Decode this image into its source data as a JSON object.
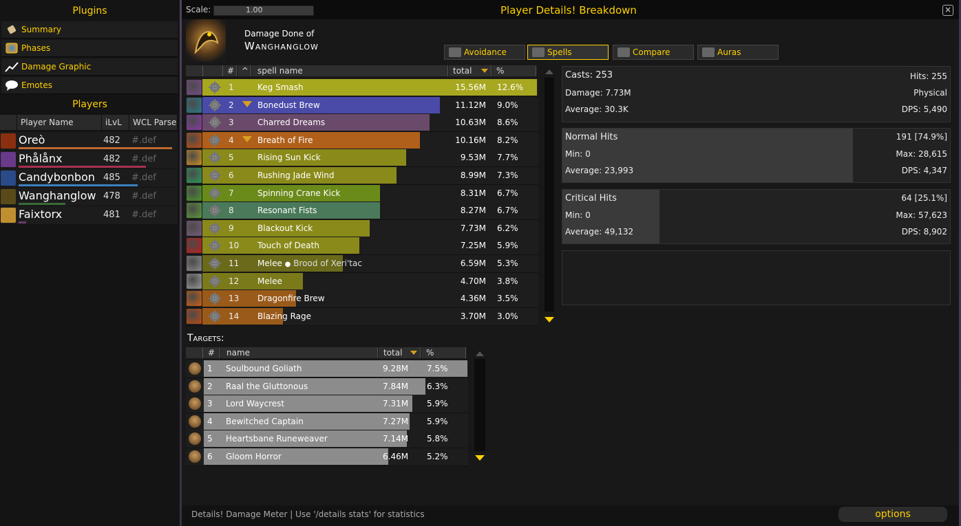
{
  "plugins": {
    "title": "Plugins",
    "items": [
      {
        "label": "Summary",
        "icon": "scroll-icon"
      },
      {
        "label": "Phases",
        "icon": "compass-icon"
      },
      {
        "label": "Damage Graphic",
        "icon": "line-chart-icon"
      },
      {
        "label": "Emotes",
        "icon": "speech-bubble-icon"
      }
    ]
  },
  "players": {
    "title": "Players",
    "headers": [
      "Player Name",
      "iLvL",
      "WCL Parse"
    ],
    "rows": [
      {
        "name": "Oreò",
        "ilvl": "482",
        "parse": "#.def",
        "color": "#8a3010",
        "bar_color": "#c06a30",
        "bar_fraction": 0.98
      },
      {
        "name": "Phålånx",
        "ilvl": "482",
        "parse": "#.def",
        "color": "#6a3a8a",
        "bar_color": "#a83050",
        "bar_fraction": 0.81
      },
      {
        "name": "Candybonbon",
        "ilvl": "485",
        "parse": "#.def",
        "color": "#2a4a8a",
        "bar_color": "#3a80c0",
        "bar_fraction": 0.76
      },
      {
        "name": "Wanghanglow",
        "ilvl": "478",
        "parse": "#.def",
        "color": "#5a4a1a",
        "bar_color": "#3a6a3a",
        "bar_fraction": 0.3
      },
      {
        "name": "Faixtorx",
        "ilvl": "481",
        "parse": "#.def",
        "color": "#c09030",
        "bar_color": "#6a3a6a",
        "bar_fraction": 0.05
      }
    ]
  },
  "window": {
    "scale_label": "Scale:",
    "scale_value": "1.00",
    "title": "Player Details! Breakdown",
    "damage_done_of": "Damage Done of",
    "player_name": "Wanghanglow"
  },
  "tabs": [
    {
      "label": "Avoidance",
      "icon": "shield-icon",
      "active": false
    },
    {
      "label": "Spells",
      "icon": "swords-icon",
      "active": true
    },
    {
      "label": "Compare",
      "icon": "crown-icon",
      "active": false
    },
    {
      "label": "Auras",
      "icon": "aura-icon",
      "active": false
    }
  ],
  "spell_table": {
    "headers": {
      "num": "#",
      "sort": "^",
      "name": "spell name",
      "total": "total",
      "pct": "%"
    },
    "rows": [
      {
        "num": "1",
        "name": "Keg Smash",
        "total": "15.56M",
        "pct": "12.6%",
        "fraction": 1.0,
        "color": "#a8a820",
        "icon_color": "#7a4a8a",
        "arrow": false
      },
      {
        "num": "2",
        "name": "Bonedust Brew",
        "total": "11.12M",
        "pct": "9.0%",
        "fraction": 0.71,
        "color": "#4a4aa8",
        "icon_color": "#2a7a8a",
        "arrow": true
      },
      {
        "num": "3",
        "name": "Charred Dreams",
        "total": "10.63M",
        "pct": "8.6%",
        "fraction": 0.68,
        "color": "#6a4a6a",
        "icon_color": "#8a3aaa",
        "arrow": false
      },
      {
        "num": "4",
        "name": "Breath of Fire",
        "total": "10.16M",
        "pct": "8.2%",
        "fraction": 0.65,
        "color": "#b0601a",
        "icon_color": "#c05010",
        "arrow": true
      },
      {
        "num": "5",
        "name": "Rising Sun Kick",
        "total": "9.53M",
        "pct": "7.7%",
        "fraction": 0.61,
        "color": "#8a8a1a",
        "icon_color": "#d09020",
        "arrow": false
      },
      {
        "num": "6",
        "name": "Rushing Jade Wind",
        "total": "8.99M",
        "pct": "7.3%",
        "fraction": 0.58,
        "color": "#8a8a1a",
        "icon_color": "#2a9a5a",
        "arrow": false
      },
      {
        "num": "7",
        "name": "Spinning Crane Kick",
        "total": "8.31M",
        "pct": "6.7%",
        "fraction": 0.53,
        "color": "#6a8a1a",
        "icon_color": "#4a9a2a",
        "arrow": false
      },
      {
        "num": "8",
        "name": "Resonant Fists",
        "total": "8.27M",
        "pct": "6.7%",
        "fraction": 0.53,
        "color": "#4a7a5a",
        "icon_color": "#5a9a3a",
        "arrow": false
      },
      {
        "num": "9",
        "name": "Blackout Kick",
        "total": "7.73M",
        "pct": "6.2%",
        "fraction": 0.5,
        "color": "#8a8a1a",
        "icon_color": "#7a5a7a",
        "arrow": false
      },
      {
        "num": "10",
        "name": "Touch of Death",
        "total": "7.25M",
        "pct": "5.9%",
        "fraction": 0.47,
        "color": "#8a8a1a",
        "icon_color": "#c01a1a",
        "arrow": false
      },
      {
        "num": "11",
        "name": "Melee",
        "pet": "Brood of Xeri'tac",
        "total": "6.59M",
        "pct": "5.3%",
        "fraction": 0.42,
        "color": "#6a6a1a",
        "icon_color": "#8a8a8a",
        "arrow": false
      },
      {
        "num": "12",
        "name": "Melee",
        "total": "4.70M",
        "pct": "3.8%",
        "fraction": 0.3,
        "color": "#7a7a1a",
        "icon_color": "#9a9a9a",
        "arrow": false
      },
      {
        "num": "13",
        "name": "Dragonfire Brew",
        "total": "4.36M",
        "pct": "3.5%",
        "fraction": 0.28,
        "color": "#9a5a1a",
        "icon_color": "#d06010",
        "arrow": false
      },
      {
        "num": "14",
        "name": "Blazing Rage",
        "total": "3.70M",
        "pct": "3.0%",
        "fraction": 0.24,
        "color": "#9a5a1a",
        "icon_color": "#c04a10",
        "arrow": false
      }
    ]
  },
  "targets": {
    "title": "Targets:",
    "headers": {
      "num": "#",
      "name": "name",
      "total": "total",
      "pct": "%"
    },
    "rows": [
      {
        "num": "1",
        "name": "Soulbound Goliath",
        "total": "9.28M",
        "pct": "7.5%",
        "fraction": 1.0
      },
      {
        "num": "2",
        "name": "Raal the Gluttonous",
        "total": "7.84M",
        "pct": "6.3%",
        "fraction": 0.84
      },
      {
        "num": "3",
        "name": "Lord Waycrest",
        "total": "7.31M",
        "pct": "5.9%",
        "fraction": 0.79
      },
      {
        "num": "4",
        "name": "Bewitched Captain",
        "total": "7.27M",
        "pct": "5.9%",
        "fraction": 0.78
      },
      {
        "num": "5",
        "name": "Heartsbane Runeweaver",
        "total": "7.14M",
        "pct": "5.8%",
        "fraction": 0.77
      },
      {
        "num": "6",
        "name": "Gloom Horror",
        "total": "6.46M",
        "pct": "5.2%",
        "fraction": 0.7
      }
    ]
  },
  "summary": {
    "casts": "Casts: 253",
    "hits": "Hits: 255",
    "damage": "Damage: 7.73M",
    "school": "Physical",
    "average": "Average: 30.3K",
    "dps": "DPS: 5,490"
  },
  "normal_hits": {
    "title": "Normal Hits",
    "count": "191 [74.9%]",
    "min": "Min: 0",
    "max": "Max: 28,615",
    "average": "Average: 23,993",
    "dps": "DPS: 4,347",
    "fraction": 0.749
  },
  "critical_hits": {
    "title": "Critical Hits",
    "count": "64 [25.1%]",
    "min": "Min: 0",
    "max": "Max: 57,623",
    "average": "Average: 49,132",
    "dps": "DPS: 8,902",
    "fraction": 0.251
  },
  "footer": {
    "status": "Details! Damage Meter | Use '/details stats' for statistics",
    "options": "options"
  }
}
